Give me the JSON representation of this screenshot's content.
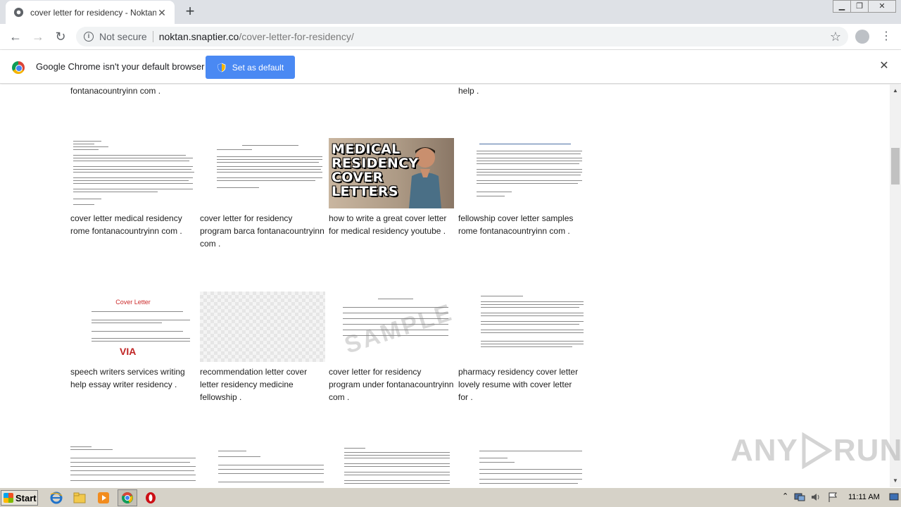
{
  "browser": {
    "tab_title": "cover letter for residency - Noktan.s",
    "tab_close": "✕",
    "new_tab": "+",
    "security_label": "Not secure",
    "url_host": "noktan.snaptier.co",
    "url_path": "/cover-letter-for-residency/"
  },
  "infobar": {
    "message": "Google Chrome isn't your default browser",
    "button_label": "Set as default",
    "close": "✕"
  },
  "gallery": {
    "top_partial": [
      {
        "caption": "fontanacountryinn com ."
      },
      {
        "caption": "help ."
      }
    ],
    "row1": [
      {
        "caption": "cover letter medical residency rome fontanacountryinn com ."
      },
      {
        "caption": "cover letter for residency program barca fontanacountryinn com ."
      },
      {
        "caption": "how to write a great cover letter for medical residency youtube ."
      },
      {
        "caption": "fellowship cover letter samples rome fontanacountryinn com ."
      }
    ],
    "row2": [
      {
        "caption": "speech writers services writing help essay writer residency ."
      },
      {
        "caption": "recommendation letter cover letter residency medicine fellowship ."
      },
      {
        "caption": "cover letter for residency program under fontanacountryinn com ."
      },
      {
        "caption": "pharmacy residency cover letter lovely resume with cover letter for ."
      }
    ],
    "video_thumb_text": "MEDICAL RESIDENCY COVER LETTERS",
    "cover_letter_thumb_title": "Cover Letter",
    "cover_letter_thumb_logo": "VIA",
    "sample_watermark": "SAMPLE"
  },
  "watermark": {
    "left": "ANY",
    "right": "RUN"
  },
  "taskbar": {
    "start_label": "Start",
    "clock": "11:11 AM"
  },
  "icons": [
    "globe-icon",
    "close-icon",
    "plus-icon",
    "back-icon",
    "forward-icon",
    "reload-icon",
    "info-icon",
    "star-icon",
    "profile-icon",
    "menu-icon",
    "chrome-icon",
    "shield-icon",
    "ie-icon",
    "folder-icon",
    "media-player-icon",
    "opera-icon"
  ]
}
